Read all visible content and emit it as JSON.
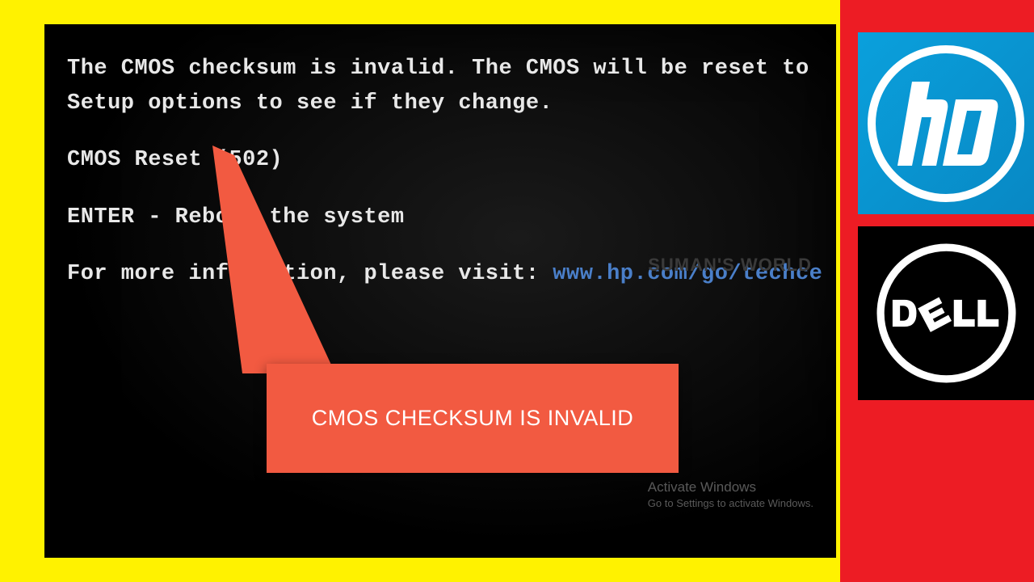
{
  "bios": {
    "line1": "The CMOS checksum is invalid. The CMOS will be reset to",
    "line2": "Setup options to see if they change.",
    "line3": "CMOS Reset (502)",
    "line4": "ENTER - Reboot the system",
    "line5a": "For more information, please visit: ",
    "line5b": "www.hp.com/go/techce"
  },
  "watermark": "SUMAN'S WORLD",
  "activate": {
    "title": "Activate Windows",
    "sub": "Go to Settings to activate Windows."
  },
  "callout": "CMOS CHECKSUM IS INVALID",
  "logos": {
    "hp": "hp",
    "dell": "DELL"
  }
}
